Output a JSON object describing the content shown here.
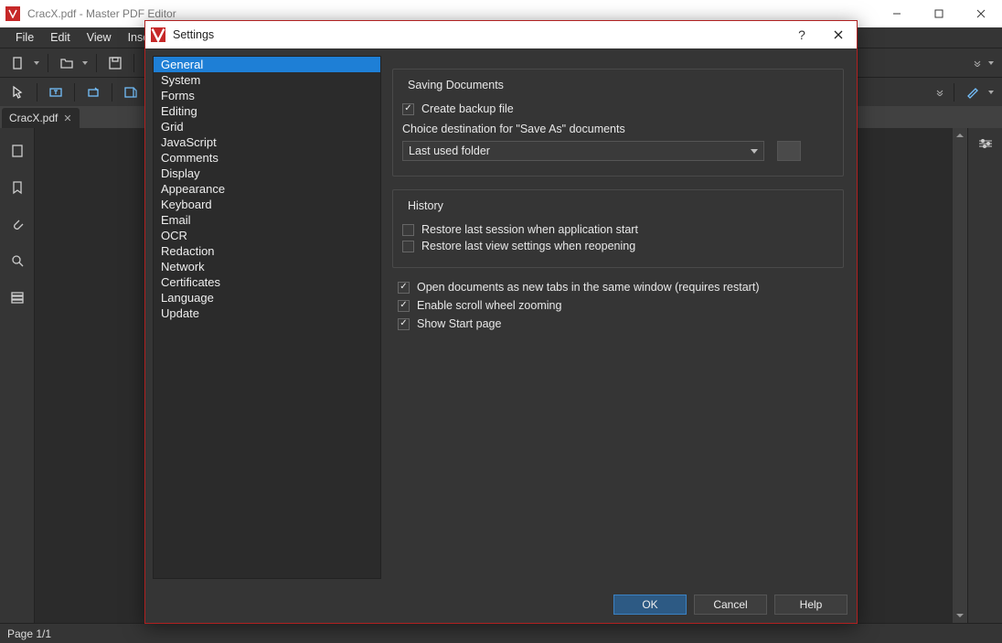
{
  "window": {
    "title": "CracX.pdf - Master PDF Editor"
  },
  "menubar": [
    "File",
    "Edit",
    "View",
    "Insert"
  ],
  "tab": {
    "label": "CracX.pdf"
  },
  "status": {
    "pages": "Page 1/1"
  },
  "dialog": {
    "title": "Settings",
    "categories": [
      "General",
      "System",
      "Forms",
      "Editing",
      "Grid",
      "JavaScript",
      "Comments",
      "Display",
      "Appearance",
      "Keyboard",
      "Email",
      "OCR",
      "Redaction",
      "Network",
      "Certificates",
      "Language",
      "Update"
    ],
    "selected_category": "General",
    "saving": {
      "group_title": "Saving Documents",
      "backup_label": "Create backup file",
      "backup_checked": true,
      "dest_label": "Choice destination for \"Save As\" documents",
      "dest_value": "Last used folder"
    },
    "history": {
      "group_title": "History",
      "restore_session_label": "Restore last session when application start",
      "restore_session_checked": false,
      "restore_view_label": "Restore last view settings when reopening",
      "restore_view_checked": false
    },
    "opts": {
      "tabs_label": "Open documents as new tabs in the same window (requires restart)",
      "tabs_checked": true,
      "zoom_label": "Enable scroll wheel zooming",
      "zoom_checked": true,
      "start_label": "Show Start page",
      "start_checked": true
    },
    "buttons": {
      "ok": "OK",
      "cancel": "Cancel",
      "help": "Help"
    }
  }
}
